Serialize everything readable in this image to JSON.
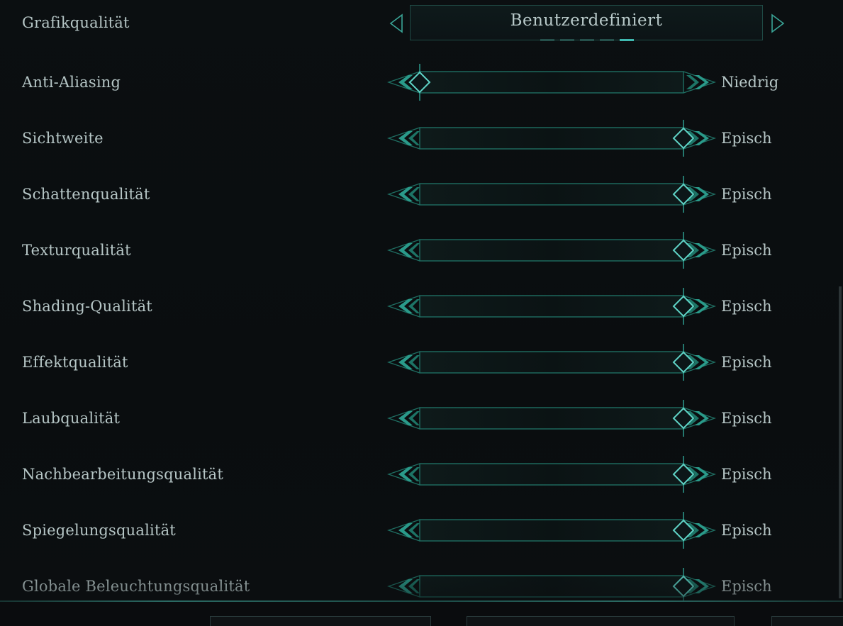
{
  "preset": {
    "label": "Grafikqualität",
    "value": "Benutzerdefiniert",
    "page_count": 5,
    "active_page": 5
  },
  "settings": [
    {
      "label": "Anti-Aliasing",
      "value": "Niedrig",
      "level": 0
    },
    {
      "label": "Sichtweite",
      "value": "Episch",
      "level": 1
    },
    {
      "label": "Schattenqualität",
      "value": "Episch",
      "level": 1
    },
    {
      "label": "Texturqualität",
      "value": "Episch",
      "level": 1
    },
    {
      "label": "Shading-Qualität",
      "value": "Episch",
      "level": 1
    },
    {
      "label": "Effektqualität",
      "value": "Episch",
      "level": 1
    },
    {
      "label": "Laubqualität",
      "value": "Episch",
      "level": 1
    },
    {
      "label": "Nachbearbeitungsqualität",
      "value": "Episch",
      "level": 1
    },
    {
      "label": "Spiegelungsqualität",
      "value": "Episch",
      "level": 1
    },
    {
      "label": "Globale Beleuchtungsqualität",
      "value": "Episch",
      "level": 1
    }
  ],
  "colors": {
    "accent": "#2fa596",
    "accent_bright": "#5fd3c6",
    "track_border": "#1f6e62",
    "text": "#b6c6c6",
    "background": "#0b0e10"
  },
  "icons": {
    "prev": "triangle-left-icon",
    "next": "triangle-right-icon",
    "decrease": "double-chevron-left-icon",
    "increase": "double-chevron-right-icon",
    "thumb": "diamond-thumb-icon"
  }
}
